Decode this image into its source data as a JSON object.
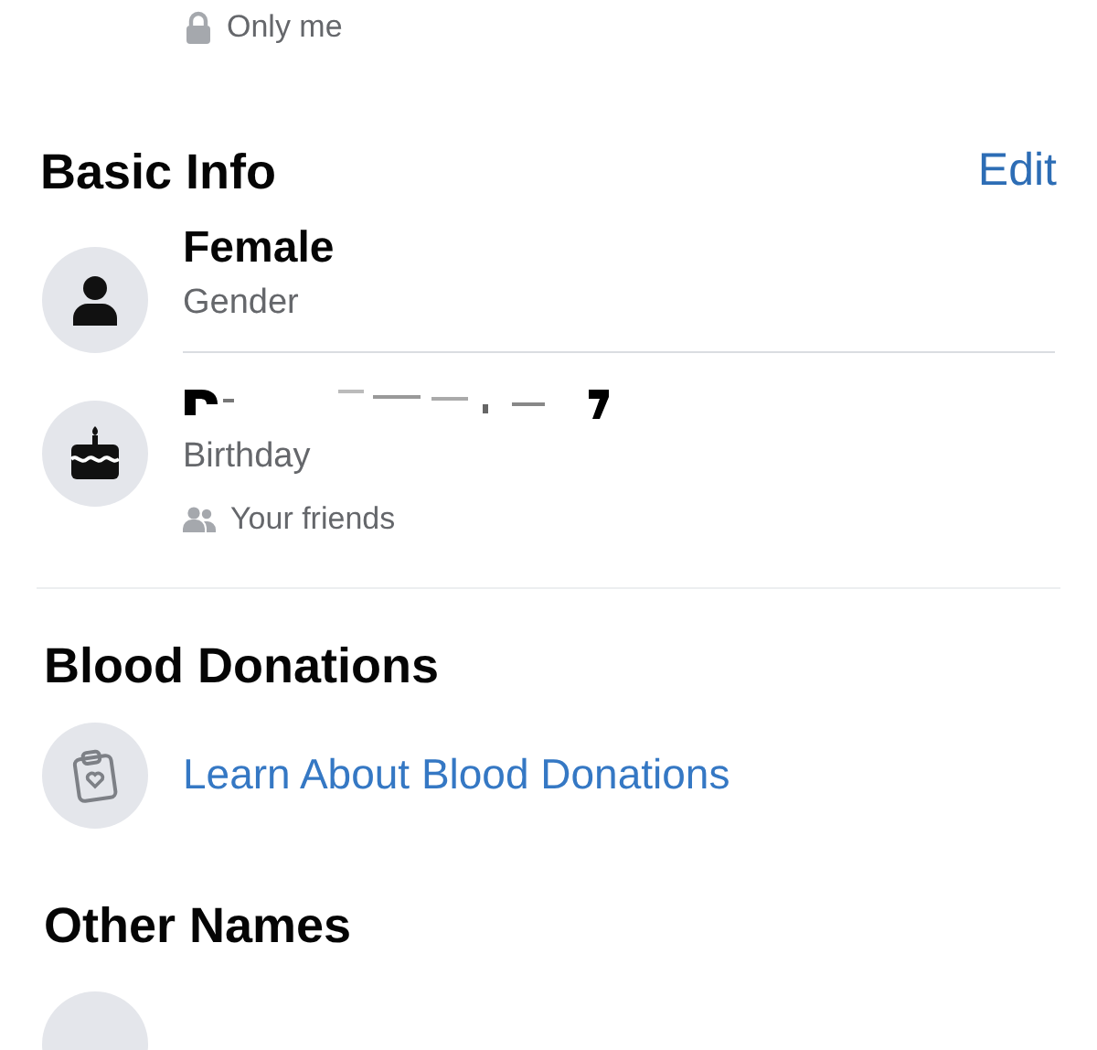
{
  "privacy_top": {
    "label": "Only me"
  },
  "basic_info": {
    "title": "Basic Info",
    "edit": "Edit",
    "items": [
      {
        "kind": "gender",
        "value": "Female",
        "label": "Gender"
      },
      {
        "kind": "birthday",
        "redacted": true,
        "label": "Birthday",
        "audience": "Your friends"
      }
    ]
  },
  "blood_donations": {
    "title": "Blood Donations",
    "link": "Learn About Blood Donations"
  },
  "other_names": {
    "title": "Other Names"
  }
}
